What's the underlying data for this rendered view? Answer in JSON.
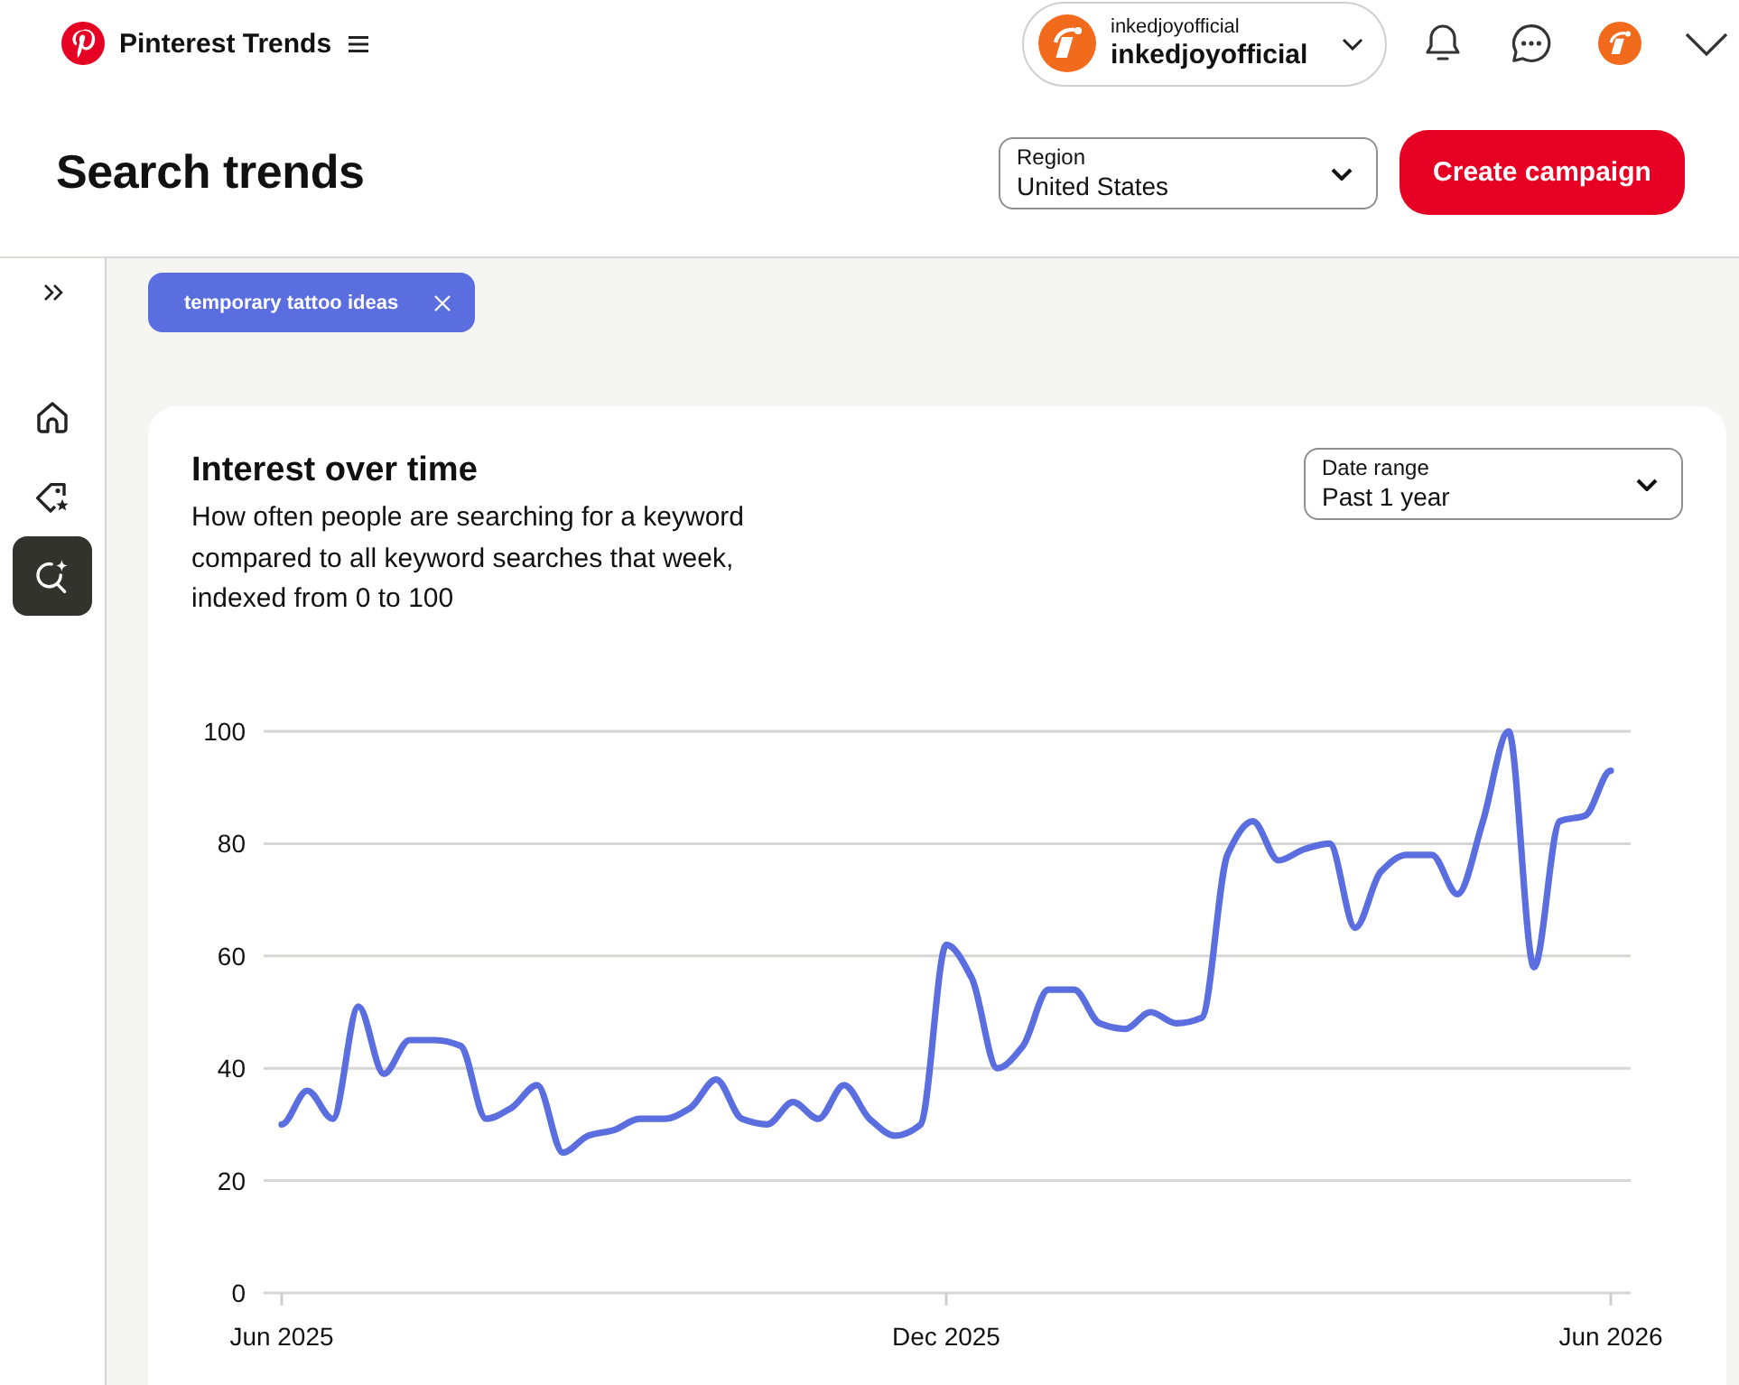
{
  "header": {
    "app_name": "Pinterest Trends",
    "account": {
      "label": "inkedjoyofficial",
      "name": "inkedjoyofficial"
    }
  },
  "page": {
    "title": "Search trends",
    "region": {
      "label": "Region",
      "value": "United States"
    },
    "action": "Create campaign"
  },
  "sidebar": {
    "items": [
      {
        "selected": false
      },
      {
        "selected": false
      },
      {
        "selected": true
      }
    ]
  },
  "keywords": [
    {
      "label": "temporary tattoo ideas",
      "color": "#5a6ee0"
    }
  ],
  "card": {
    "title": "Interest over time",
    "description": "How often people are searching for a keyword compared to all keyword searches that week, indexed from 0 to 100",
    "date_range": {
      "label": "Date range",
      "value": "Past 1 year"
    },
    "chart_data": {
      "type": "line",
      "categories": [
        "Jun 2025",
        null,
        null,
        null,
        null,
        null,
        null,
        null,
        null,
        null,
        null,
        null,
        null,
        null,
        null,
        null,
        null,
        null,
        null,
        null,
        null,
        null,
        null,
        null,
        null,
        null,
        "Dec 2025",
        null,
        null,
        null,
        null,
        null,
        null,
        null,
        null,
        null,
        null,
        null,
        null,
        null,
        null,
        null,
        null,
        null,
        null,
        null,
        null,
        null,
        null,
        null,
        null,
        null,
        "Jun 2026"
      ],
      "values": [
        30,
        36,
        31,
        51,
        39,
        45,
        45,
        44,
        31,
        33,
        37,
        25,
        28,
        29,
        31,
        31,
        33,
        38,
        31,
        30,
        34,
        31,
        37,
        31,
        28,
        30,
        62,
        56,
        40,
        44,
        54,
        54,
        48,
        47,
        50,
        48,
        49,
        78,
        84,
        77,
        79,
        80,
        65,
        75,
        78,
        78,
        71,
        84,
        100,
        58,
        84,
        85,
        93
      ],
      "ylim": [
        0,
        100
      ],
      "yticks": [
        0,
        20,
        40,
        60,
        80,
        100
      ],
      "grid": true
    }
  }
}
